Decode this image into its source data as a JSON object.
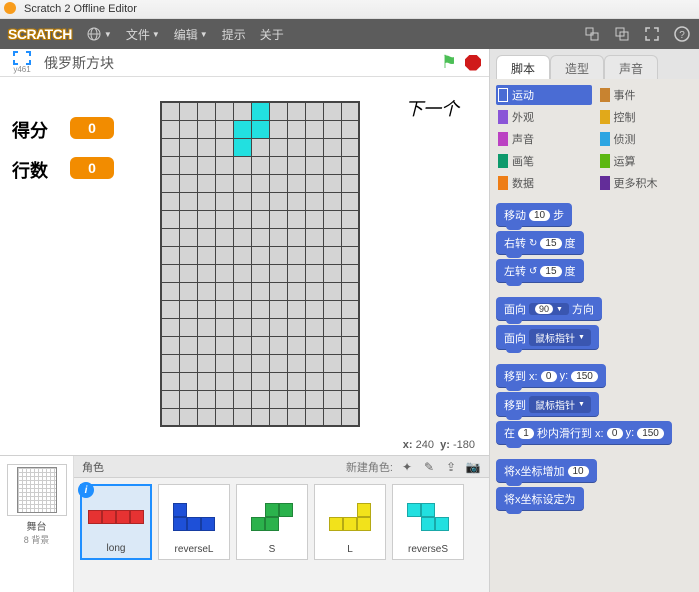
{
  "app": {
    "title": "Scratch 2 Offline Editor",
    "logo_text": "SCRATCH"
  },
  "menubar": {
    "items": [
      "文件",
      "编辑",
      "提示",
      "关于"
    ],
    "globe_icon": "globe-icon"
  },
  "stage_header": {
    "expand_label": "y461",
    "project_title": "俄罗斯方块"
  },
  "stage": {
    "next_label": "下一个",
    "score_label": "得分",
    "lines_label": "行数",
    "score_value": "0",
    "lines_value": "0",
    "coords_x_label": "x:",
    "coords_x": "240",
    "coords_y_label": "y:",
    "coords_y": "-180"
  },
  "sprites_panel": {
    "stage_label": "舞台",
    "stage_sub": "8 背景",
    "header_title": "角色",
    "new_sprite_label": "新建角色:",
    "items": [
      {
        "name": "long"
      },
      {
        "name": "reverseL"
      },
      {
        "name": "S"
      },
      {
        "name": "L"
      },
      {
        "name": "reverseS"
      }
    ]
  },
  "tabs": {
    "items": [
      "脚本",
      "造型",
      "声音"
    ],
    "active": 0
  },
  "categories": [
    {
      "label": "运动",
      "color": "#4a6cd4",
      "selected": true
    },
    {
      "label": "事件",
      "color": "#c88330"
    },
    {
      "label": "外观",
      "color": "#8a55d7"
    },
    {
      "label": "控制",
      "color": "#e1a91a"
    },
    {
      "label": "声音",
      "color": "#bb42c3"
    },
    {
      "label": "侦测",
      "color": "#2ca5e2"
    },
    {
      "label": "画笔",
      "color": "#0e9a6c"
    },
    {
      "label": "运算",
      "color": "#5cb712"
    },
    {
      "label": "数据",
      "color": "#ee7d16"
    },
    {
      "label": "更多积木",
      "color": "#632d99"
    }
  ],
  "blocks": {
    "b1": {
      "pre": "移动",
      "v": "10",
      "post": "步"
    },
    "b2": {
      "pre": "右转",
      "v": "15",
      "post": "度"
    },
    "b3": {
      "pre": "左转",
      "v": "15",
      "post": "度"
    },
    "b4": {
      "pre": "面向",
      "v": "90",
      "post": "方向"
    },
    "b5": {
      "pre": "面向",
      "dd": "鼠标指针"
    },
    "b6": {
      "pre": "移到 x:",
      "vx": "0",
      "mid": "y:",
      "vy": "150"
    },
    "b7": {
      "pre": "移到",
      "dd": "鼠标指针"
    },
    "b8": {
      "pre": "在",
      "vt": "1",
      "mid": "秒内滑行到 x:",
      "vx": "0",
      "mid2": "y:",
      "vy": "150"
    },
    "b9": {
      "pre": "将x坐标增加",
      "v": "10"
    },
    "b10": {
      "pre": "将x坐标设定为"
    }
  }
}
